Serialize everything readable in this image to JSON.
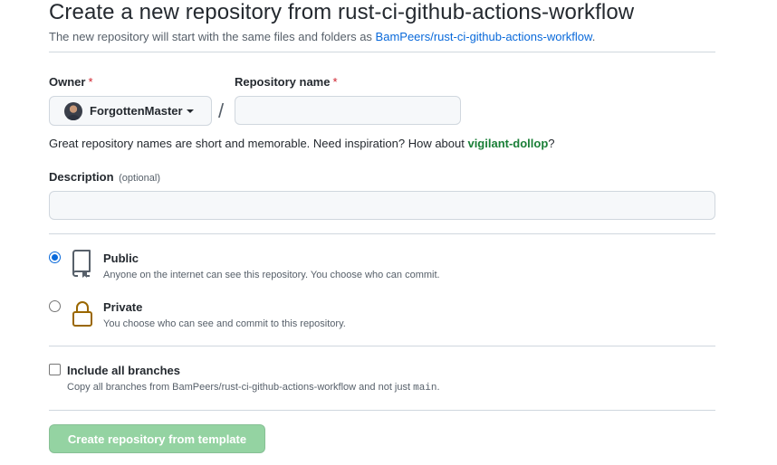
{
  "header": {
    "title": "Create a new repository from rust-ci-github-actions-workflow",
    "subtitle_prefix": "The new repository will start with the same files and folders as ",
    "template_link": "BamPeers/rust-ci-github-actions-workflow",
    "subtitle_suffix": "."
  },
  "owner": {
    "label": "Owner",
    "required_mark": "*",
    "selected": "ForgottenMaster"
  },
  "separator": "/",
  "repo_name": {
    "label": "Repository name",
    "required_mark": "*",
    "value": ""
  },
  "hint": {
    "text": "Great repository names are short and memorable. Need inspiration? How about ",
    "suggestion": "vigilant-dollop",
    "suffix": "?"
  },
  "description": {
    "label": "Description",
    "optional": "(optional)",
    "value": ""
  },
  "visibility": {
    "public": {
      "title": "Public",
      "desc": "Anyone on the internet can see this repository. You choose who can commit.",
      "checked": true
    },
    "private": {
      "title": "Private",
      "desc": "You choose who can see and commit to this repository.",
      "checked": false
    }
  },
  "include_branches": {
    "label": "Include all branches",
    "desc_prefix": "Copy all branches from BamPeers/rust-ci-github-actions-workflow and not just ",
    "desc_code": "main",
    "desc_suffix": ".",
    "checked": false
  },
  "submit": {
    "label": "Create repository from template",
    "enabled": false
  },
  "colors": {
    "link": "#0969da",
    "suggestion": "#1a7f37",
    "required": "#cf222e",
    "submit_disabled_bg": "#94d3a2",
    "private_icon": "#9a6700"
  },
  "icons": {
    "public": "repo-icon",
    "private": "lock-icon",
    "owner_dropdown": "caret-down-icon"
  }
}
